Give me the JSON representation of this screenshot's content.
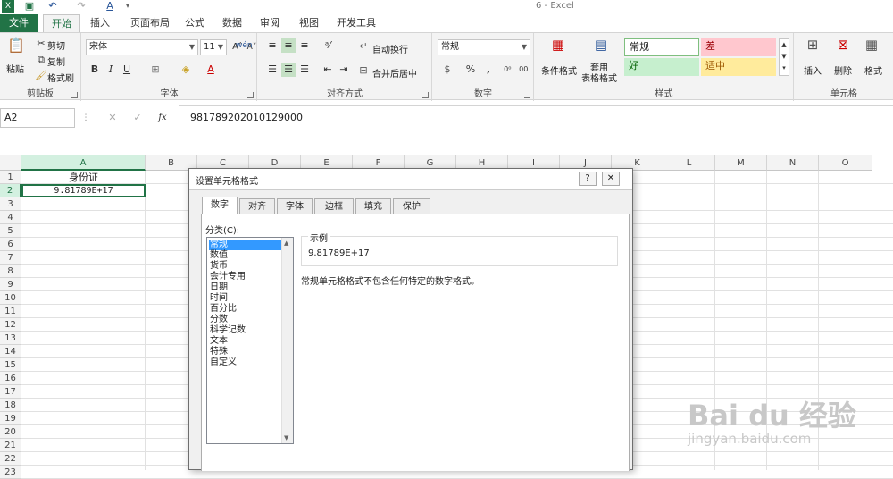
{
  "window": {
    "title": "6 - Excel"
  },
  "tabs": [
    "文件",
    "开始",
    "插入",
    "页面布局",
    "公式",
    "数据",
    "审阅",
    "视图",
    "开发工具"
  ],
  "clipboard": {
    "paste": "粘贴",
    "cut": "剪切",
    "copy": "复制",
    "format_painter": "格式刷",
    "label": "剪贴板"
  },
  "font": {
    "name": "宋体",
    "size": "11",
    "label": "字体",
    "bold": "B",
    "italic": "I",
    "underline": "U"
  },
  "alignment": {
    "wrap": "自动换行",
    "merge": "合并后居中",
    "label": "对齐方式"
  },
  "number": {
    "format": "常规",
    "percent": "%",
    "comma": ",",
    "label": "数字"
  },
  "styles": {
    "cond": "条件格式",
    "table": "套用\n表格格式",
    "normal": "常规",
    "bad": "差",
    "good": "好",
    "neutral": "适中",
    "label": "样式",
    "colors": {
      "normal": "#ffffff",
      "bad": "#ffc7ce",
      "good": "#c6efce",
      "neutral": "#ffeb9c"
    }
  },
  "cells_group": {
    "insert": "插入",
    "delete": "删除",
    "format": "格式",
    "label": "单元格"
  },
  "formula_bar": {
    "name_box": "A2",
    "value": "981789202010129000",
    "fx": "fx"
  },
  "sheet": {
    "columns": [
      "A",
      "B",
      "C",
      "D",
      "E",
      "F",
      "G",
      "H",
      "I",
      "J",
      "K",
      "L",
      "M",
      "N",
      "O"
    ],
    "rows": [
      "1",
      "2",
      "3",
      "4",
      "5",
      "6",
      "7",
      "8",
      "9",
      "10",
      "11",
      "12",
      "13",
      "14",
      "15",
      "16",
      "17",
      "18",
      "19",
      "20",
      "21",
      "22",
      "23"
    ],
    "a1": "身份证",
    "a2": "9.81789E+17"
  },
  "dialog": {
    "title": "设置单元格格式",
    "help": "?",
    "close": "✕",
    "tabs": [
      "数字",
      "对齐",
      "字体",
      "边框",
      "填充",
      "保护"
    ],
    "category_label": "分类(C):",
    "categories": [
      "常规",
      "数值",
      "货币",
      "会计专用",
      "日期",
      "时间",
      "百分比",
      "分数",
      "科学记数",
      "文本",
      "特殊",
      "自定义"
    ],
    "sample_label": "示例",
    "sample_value": "9.81789E+17",
    "description": "常规单元格格式不包含任何特定的数字格式。"
  },
  "watermark": {
    "brand": "Bai du 经验",
    "url": "jingyan.baidu.com"
  }
}
